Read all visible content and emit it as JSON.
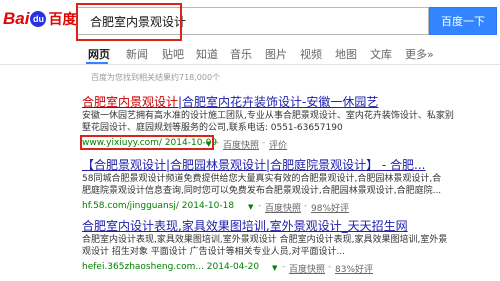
{
  "logo": {
    "bai": "Bai",
    "paw": "du",
    "du": "百度"
  },
  "search": {
    "query": "合肥室内景观设计",
    "button_label": "百度一下"
  },
  "tabs": [
    "网页",
    "新闻",
    "贴吧",
    "知道",
    "音乐",
    "图片",
    "视频",
    "地图",
    "文库",
    "更多»"
  ],
  "result_count": "百度为您找到相关结果约718,000个",
  "results": [
    {
      "title_a": "合肥室内景观设计",
      "title_b": "|合肥室内花卉装饰设计-安徽一休园艺",
      "snippet1": "安徽一休园艺拥有高水准的设计施工团队,专业从事合肥景观设计、室内花卉装饰设计、私家别",
      "snippet2": "墅花园设计、庭园规划等服务的公司,联系电话: 0551-63657190",
      "url": "www.yixiuyy.com/ 2014-10-09",
      "cache": "百度快照",
      "eval": "评价"
    },
    {
      "title_a": "【合肥景观设计|合肥园林景观设计|合肥庭院景观设计】 - 合肥...",
      "snippet1": "58同城合肥景观设计频道免费提供给您大量真实有效的合肥景观设计,合肥园林景观设计,合",
      "snippet2": "肥庭院景观设计信息查询,同时您可以免费发布合肥景观设计,合肥园林景观设计,合肥庭院...",
      "url": "hf.58.com/jingguansj/ 2014-10-18",
      "cache": "百度快照",
      "eval": "98%好评"
    },
    {
      "title_a": "合肥室内设计表现,家具效果图培训,室外景观设计_天天招生网",
      "snippet1": "合肥室内设计表现,家具效果图培训,室外景观设计 合肥室内设计表现,家具效果图培训,室外景",
      "snippet2": "观设计 招生对象 平面设计 广告设计等相关专业人员,对平面设计...",
      "url": "hefei.365zhaosheng.com... 2014-04-20",
      "cache": "百度快照",
      "eval": "83%好评"
    }
  ]
}
